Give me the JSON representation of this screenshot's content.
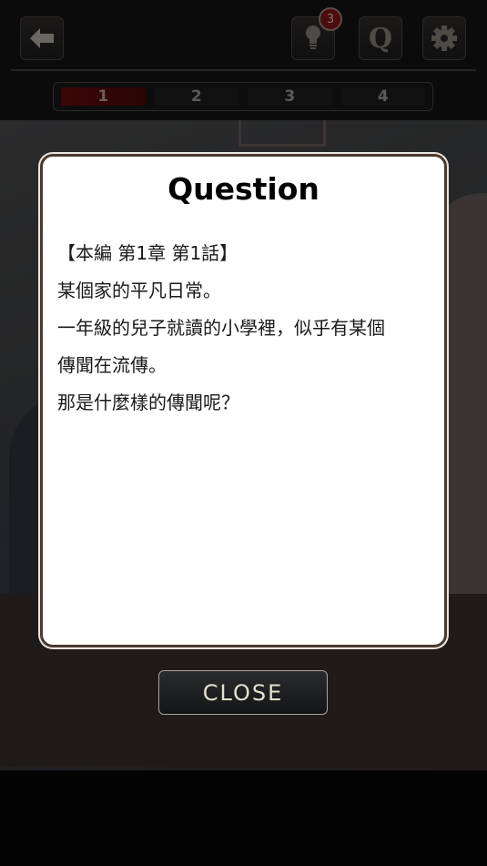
{
  "topbar": {
    "back_icon": "arrow-left-icon",
    "hint_icon": "lightbulb-icon",
    "hint_badge_count": "3",
    "question_button_label": "Q",
    "settings_icon": "gear-icon"
  },
  "tabs": [
    {
      "label": "1",
      "active": true
    },
    {
      "label": "2",
      "active": false
    },
    {
      "label": "3",
      "active": false
    },
    {
      "label": "4",
      "active": false
    }
  ],
  "dialog": {
    "title": "Question",
    "lines": [
      "【本編 第1章 第1話】",
      "某個家的平凡日常。",
      "一年級的兒子就讀的小學裡，似乎有某個",
      "傳聞在流傳。",
      "那是什麼樣的傳聞呢？"
    ]
  },
  "close_button": {
    "label": "CLOSE"
  },
  "colors": {
    "active_tab": "#3c0606",
    "badge": "#4a0c0c",
    "dialog_border": "#4a3a30",
    "close_text": "#e4e0d0"
  }
}
